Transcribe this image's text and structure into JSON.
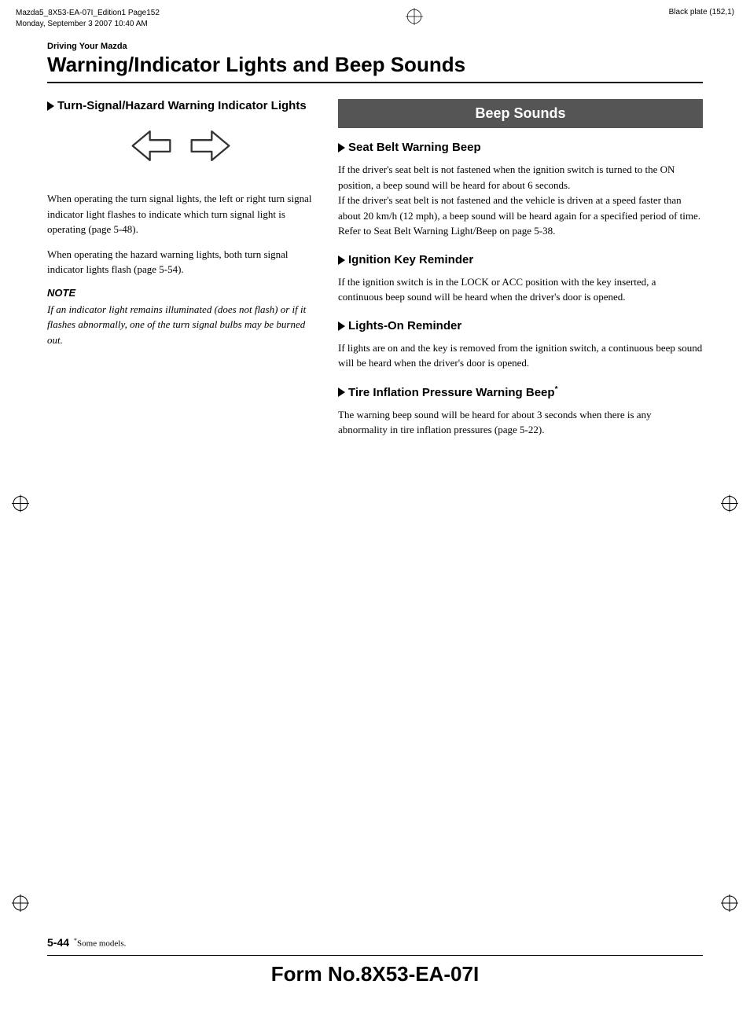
{
  "topBar": {
    "leftLine1": "Mazda5_8X53-EA-07I_Edition1 Page152",
    "leftLine2": "Monday, September 3 2007 10:40 AM",
    "rightText": "Black plate (152,1)"
  },
  "header": {
    "sectionLabel": "Driving Your Mazda",
    "pageTitle": "Warning/Indicator Lights and Beep Sounds"
  },
  "leftColumn": {
    "sectionHeading": "Turn-Signal/Hazard Warning Indicator Lights",
    "paragraph1": "When operating the turn signal lights, the left or right turn signal indicator light flashes to indicate which turn signal light is operating (page 5-48).",
    "paragraph2": "When operating the hazard warning lights, both turn signal indicator lights flash (page 5-54).",
    "noteLabel": "NOTE",
    "noteText": "If an indicator light remains illuminated (does not flash) or if it flashes abnormally, one of the turn signal bulbs may be burned out."
  },
  "rightColumn": {
    "beepSoundsHeader": "Beep Sounds",
    "sections": [
      {
        "heading": "Seat Belt Warning Beep",
        "body": "If the driver's seat belt is not fastened when the ignition switch is turned to the ON position, a beep sound will be heard for about 6 seconds.\nIf the driver's seat belt is not fastened and the vehicle is driven at a speed faster than about 20 km/h (12 mph), a beep sound will be heard again for a specified period of time.\nRefer to Seat Belt Warning Light/Beep on page 5-38."
      },
      {
        "heading": "Ignition Key Reminder",
        "body": "If the ignition switch is in the LOCK or ACC position with the key inserted, a continuous beep sound will be heard when the driver's door is opened."
      },
      {
        "heading": "Lights-On Reminder",
        "body": "If lights are on and the key is removed from the ignition switch, a continuous beep sound will be heard when the driver's door is opened."
      },
      {
        "heading": "Tire Inflation Pressure Warning Beep",
        "headingSuffix": "*",
        "body": "The warning beep sound will be heard for about 3 seconds when there is any abnormality in tire inflation pressures (page 5-22)."
      }
    ]
  },
  "footer": {
    "pageNumber": "5-44",
    "footnoteMark": "*",
    "footnoteText": "Some models.",
    "formNumber": "Form No.8X53-EA-07I"
  }
}
